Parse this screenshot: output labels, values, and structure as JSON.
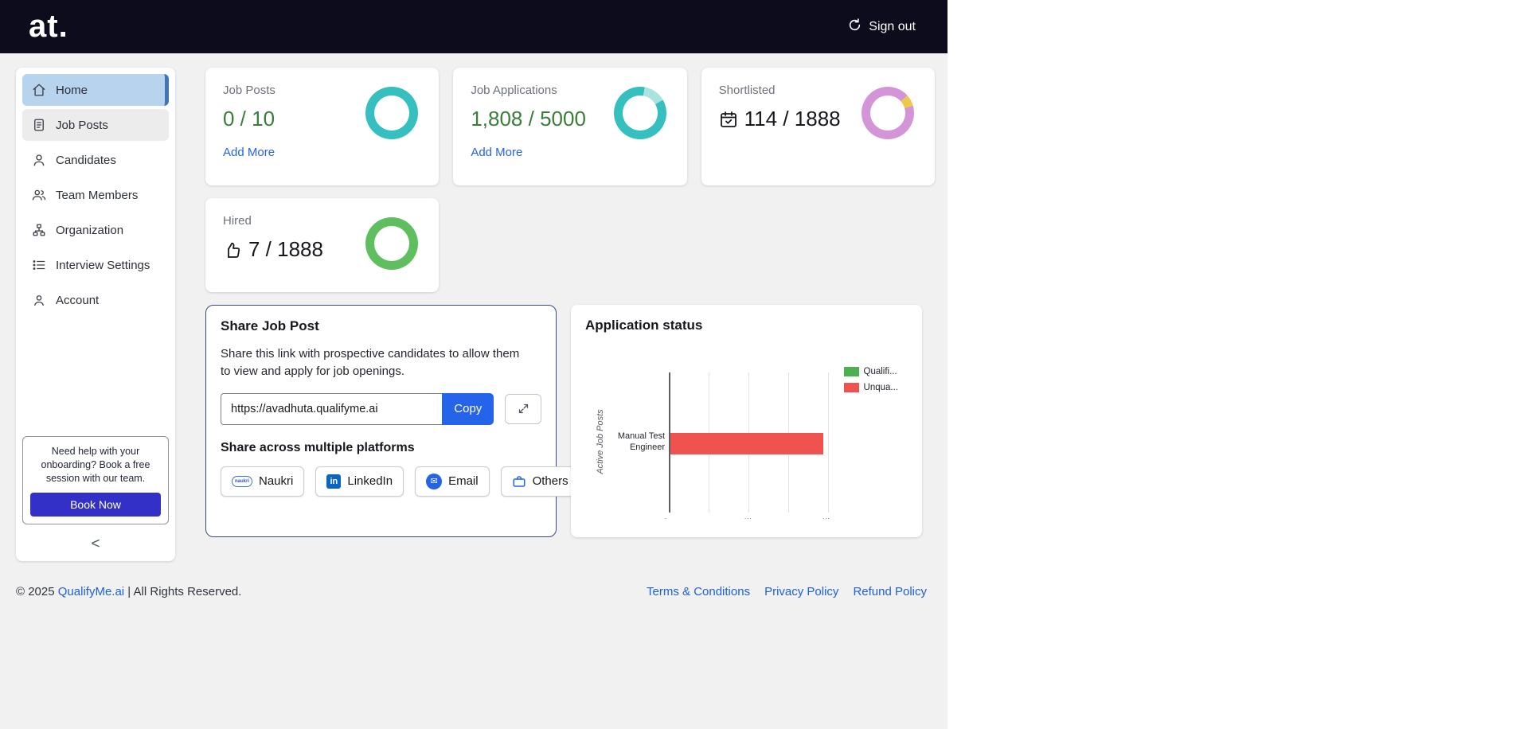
{
  "header": {
    "logo": "at.",
    "sign_out": "Sign out"
  },
  "sidebar": {
    "items": [
      {
        "label": "Home",
        "icon": "home-icon",
        "active": true
      },
      {
        "label": "Job Posts",
        "icon": "document-icon"
      },
      {
        "label": "Candidates",
        "icon": "user-icon"
      },
      {
        "label": "Team Members",
        "icon": "users-icon"
      },
      {
        "label": "Organization",
        "icon": "org-chart-icon"
      },
      {
        "label": "Interview Settings",
        "icon": "list-icon"
      },
      {
        "label": "Account",
        "icon": "account-icon"
      }
    ],
    "help_box": {
      "text": "Need help with your onboarding? Book a free session with our team.",
      "button": "Book Now"
    },
    "collapse": "<"
  },
  "stats": [
    {
      "title": "Job Posts",
      "value": "0 / 10",
      "link": "Add More",
      "ring_segments": [
        {
          "color": "#35bfbf",
          "from": 0,
          "to": 360
        }
      ]
    },
    {
      "title": "Job Applications",
      "value": "1,808 / 5000",
      "link": "Add More",
      "ring_segments": [
        {
          "color": "#35bfbf",
          "from": 0,
          "to": 10
        },
        {
          "color": "#a9e4de",
          "from": 10,
          "to": 60
        },
        {
          "color": "#35bfbf",
          "from": 60,
          "to": 360
        }
      ]
    },
    {
      "title": "Shortlisted",
      "value": "114 / 1888",
      "ring_segments": [
        {
          "color": "#d494d8",
          "from": 0,
          "to": 48
        },
        {
          "color": "#ecc94b",
          "from": 48,
          "to": 74
        },
        {
          "color": "#d494d8",
          "from": 74,
          "to": 360
        }
      ]
    },
    {
      "title": "Hired",
      "value": "7 / 1888",
      "ring_segments": [
        {
          "color": "#5fbf5f",
          "from": 0,
          "to": 360
        }
      ]
    }
  ],
  "share": {
    "title": "Share Job Post",
    "description": "Share this link with prospective candidates to allow them to view and apply for job openings.",
    "url": "https://avadhuta.qualifyme.ai",
    "copy_label": "Copy",
    "platforms_title": "Share across multiple platforms",
    "platforms": {
      "naukri": "Naukri",
      "linkedin": "LinkedIn",
      "email": "Email",
      "others": "Others"
    },
    "naukri_logo_text": "naukri",
    "linkedin_logo_text": "in",
    "email_glyph": "✉"
  },
  "application_status": {
    "title": "Application status"
  },
  "chart_data": {
    "type": "bar",
    "orientation": "horizontal",
    "title": "Application status",
    "ylabel": "Active Job Posts",
    "categories": [
      "Manual Test Engineer"
    ],
    "series": [
      {
        "name": "Qualified",
        "label_visible": "Qualifi...",
        "color": "#4caf50",
        "values": [
          0
        ]
      },
      {
        "name": "Unqualified",
        "label_visible": "Unqua...",
        "color": "#f0534f",
        "values": [
          2
        ]
      }
    ],
    "xlim": [
      0,
      2.08
    ],
    "x_tick_labels_visible": [
      ".",
      "...",
      "..."
    ],
    "grid": true,
    "legend_position": "top-right"
  },
  "footer": {
    "copyright_prefix": "© 2025 ",
    "brand": "QualifyMe.ai",
    "copyright_suffix": " | All Rights Reserved.",
    "links": [
      "Terms & Conditions",
      "Privacy Policy",
      "Refund Policy"
    ]
  },
  "colors": {
    "header_bg": "#0c0c1d",
    "accent_blue": "#2563eb",
    "active_item_bg": "#b8d3ee",
    "active_item_border": "#3f76b4",
    "green_value": "#3a7d3a",
    "book_now_bg": "#3330c8",
    "share_card_border": "#39497e",
    "bar_red": "#f0534f",
    "legend_green": "#4caf50",
    "donut_teal": "#35bfbf",
    "donut_plum": "#d494d8",
    "donut_yellow": "#ecc94b",
    "donut_green": "#5fbf5f"
  }
}
